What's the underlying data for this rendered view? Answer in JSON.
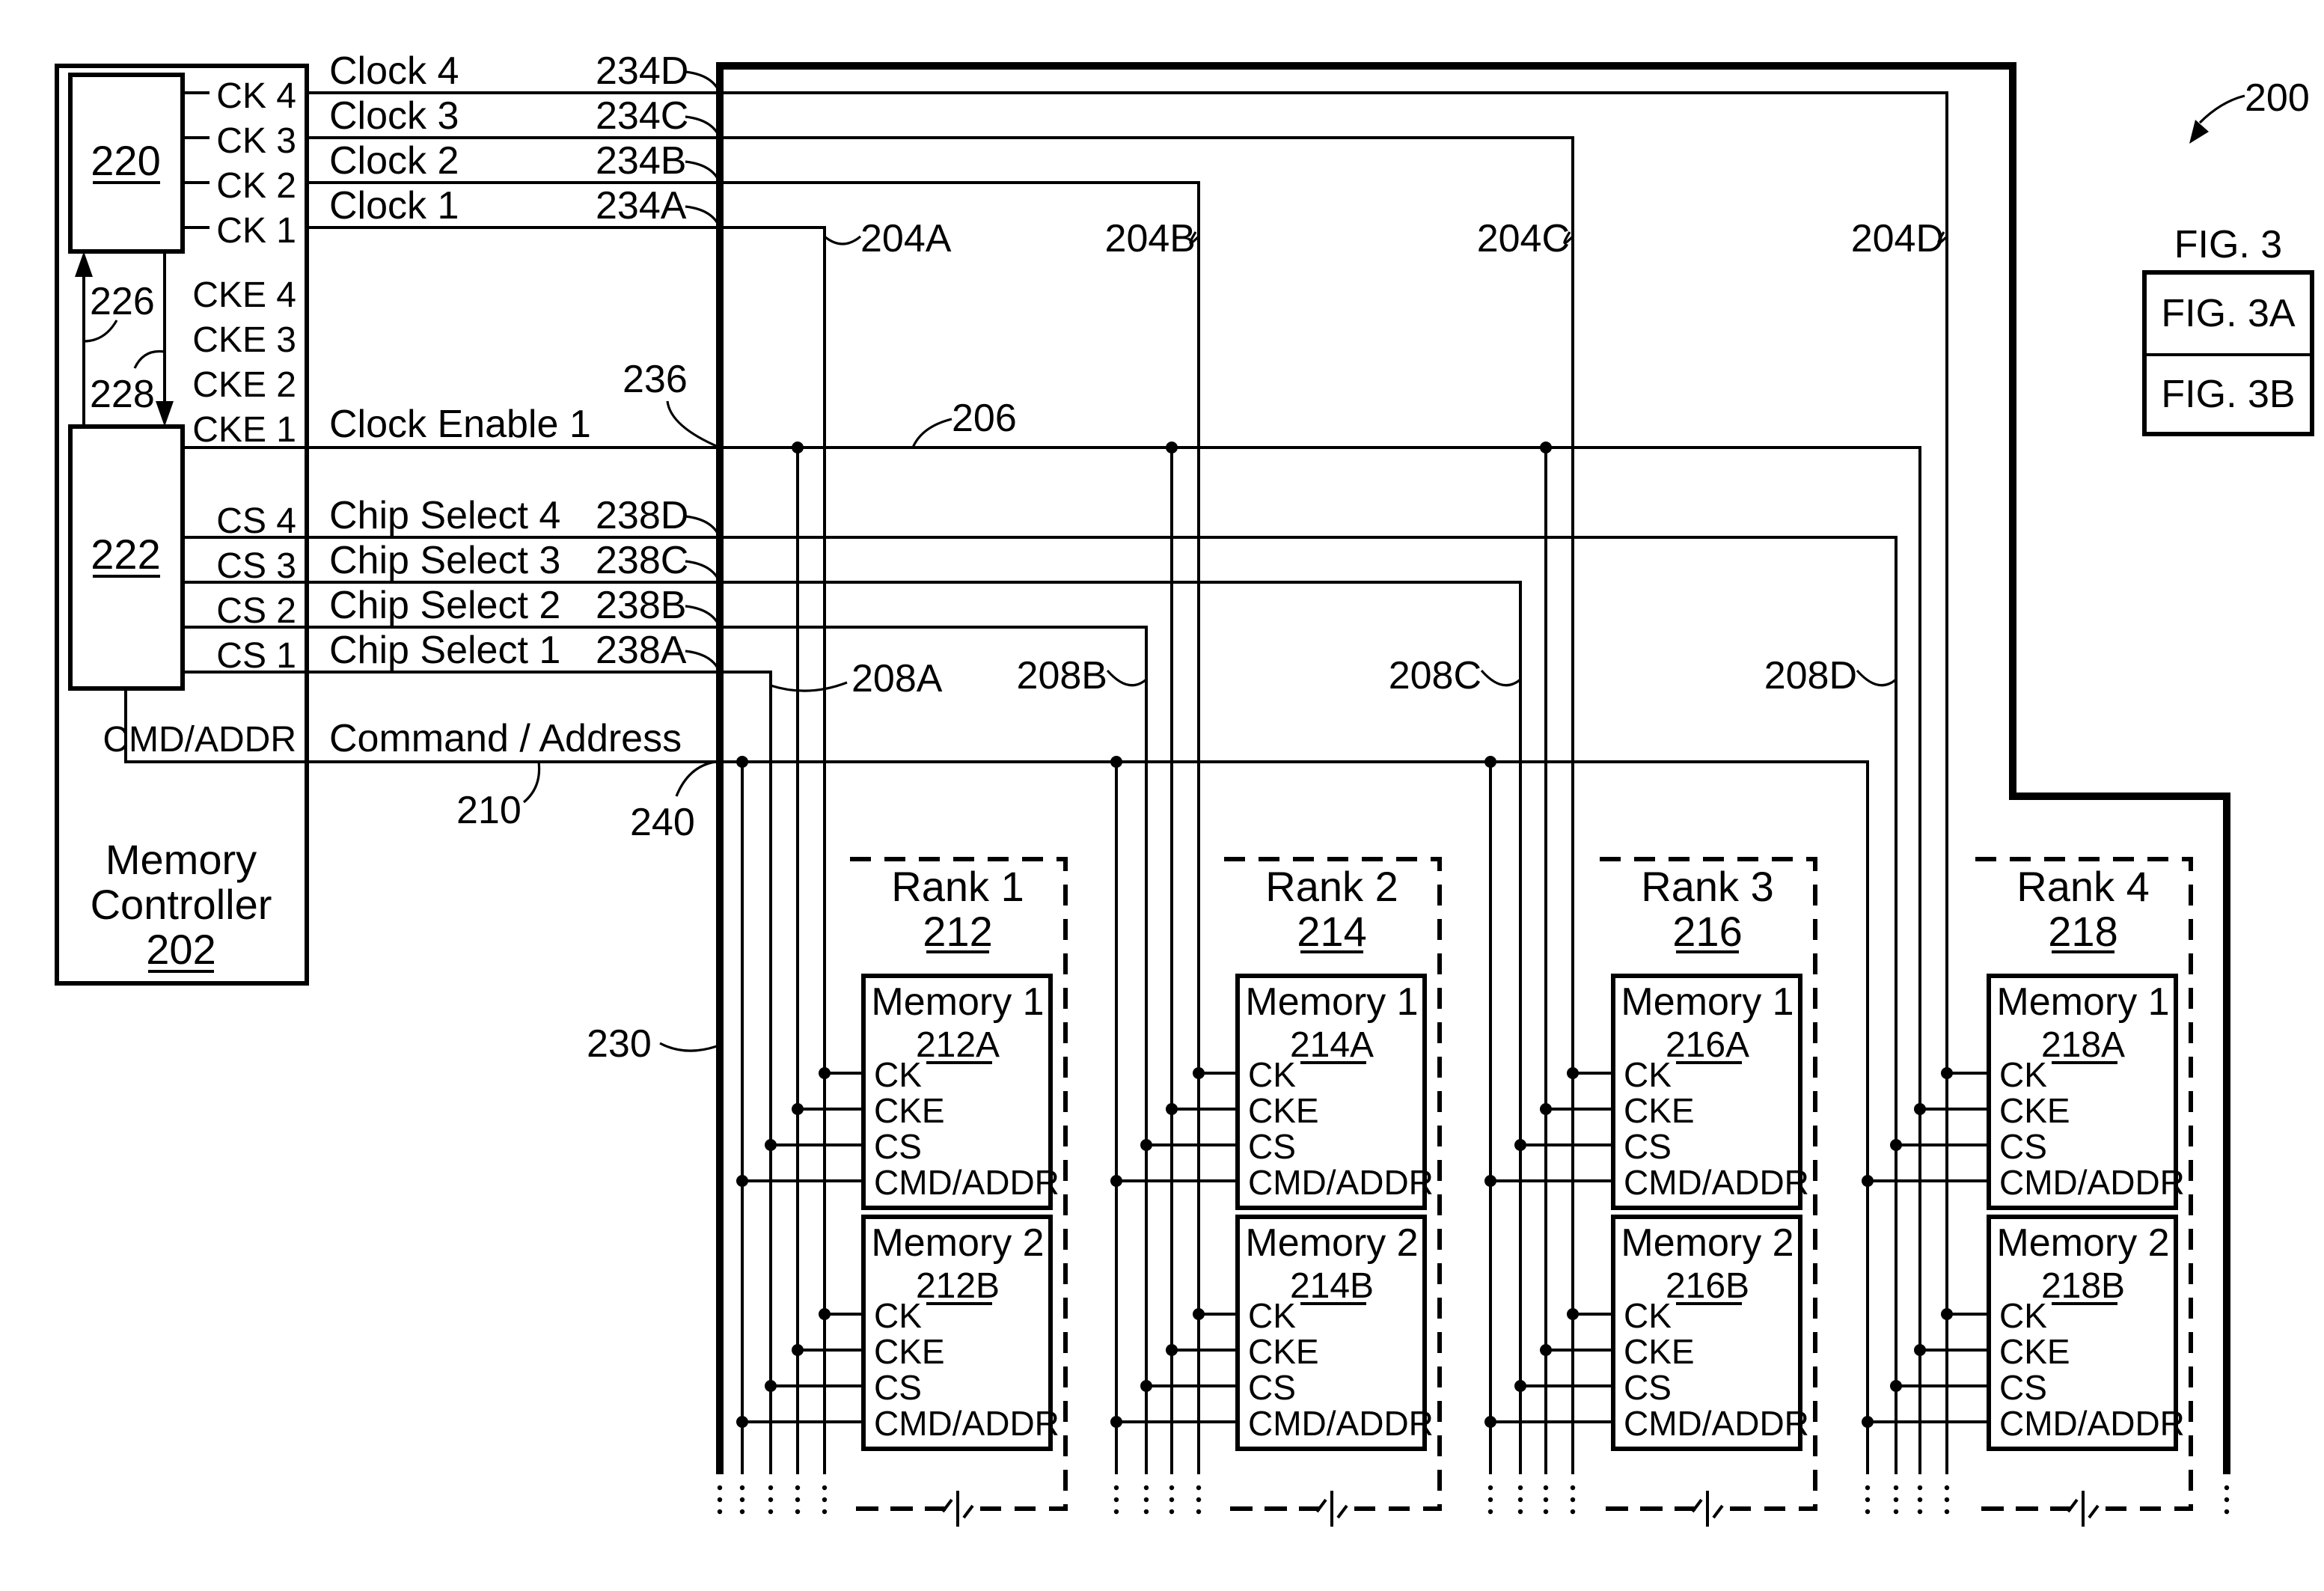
{
  "figure": {
    "ref": "200",
    "fig_title": "FIG. 3",
    "fig_parts": [
      "FIG. 3A",
      "FIG. 3B"
    ]
  },
  "controller": {
    "name_line1": "Memory",
    "name_line2": "Controller",
    "ref": "202",
    "block_220": "220",
    "block_222": "222",
    "arrow_226": "226",
    "arrow_228": "228",
    "ck_ports": [
      "CK 4",
      "CK 3",
      "CK 2",
      "CK 1"
    ],
    "cke_ports": [
      "CKE 4",
      "CKE 3",
      "CKE 2",
      "CKE 1"
    ],
    "cs_ports": [
      "CS 4",
      "CS 3",
      "CS 2",
      "CS 1"
    ],
    "cmd_port": "CMD/ADDR"
  },
  "signals": {
    "clocks": [
      {
        "label": "Clock 4",
        "ref": "234D"
      },
      {
        "label": "Clock 3",
        "ref": "234C"
      },
      {
        "label": "Clock 2",
        "ref": "234B"
      },
      {
        "label": "Clock 1",
        "ref": "234A"
      }
    ],
    "clock_enable": {
      "label": "Clock Enable 1",
      "ref": "236",
      "line_ref": "206"
    },
    "chip_selects": [
      {
        "label": "Chip Select 4",
        "ref": "238D"
      },
      {
        "label": "Chip Select 3",
        "ref": "238C"
      },
      {
        "label": "Chip Select 2",
        "ref": "238B"
      },
      {
        "label": "Chip Select 1",
        "ref": "238A"
      }
    ],
    "command_address": {
      "label": "Command / Address",
      "ref": "210",
      "junction_ref": "240"
    },
    "bus_ref": "230",
    "clock_drop_refs": [
      "204A",
      "204B",
      "204C",
      "204D"
    ],
    "cs_drop_refs": [
      "208A",
      "208B",
      "208C",
      "208D"
    ]
  },
  "ranks": [
    {
      "title": "Rank 1",
      "ref": "212",
      "memories": [
        {
          "name": "Memory 1",
          "ref": "212A"
        },
        {
          "name": "Memory 2",
          "ref": "212B"
        }
      ]
    },
    {
      "title": "Rank 2",
      "ref": "214",
      "memories": [
        {
          "name": "Memory 1",
          "ref": "214A"
        },
        {
          "name": "Memory 2",
          "ref": "214B"
        }
      ]
    },
    {
      "title": "Rank 3",
      "ref": "216",
      "memories": [
        {
          "name": "Memory 1",
          "ref": "216A"
        },
        {
          "name": "Memory 2",
          "ref": "216B"
        }
      ]
    },
    {
      "title": "Rank 4",
      "ref": "218",
      "memories": [
        {
          "name": "Memory 1",
          "ref": "218A"
        },
        {
          "name": "Memory 2",
          "ref": "218B"
        }
      ]
    }
  ],
  "memory_pins": [
    "CK",
    "CKE",
    "CS",
    "CMD/ADDR"
  ]
}
